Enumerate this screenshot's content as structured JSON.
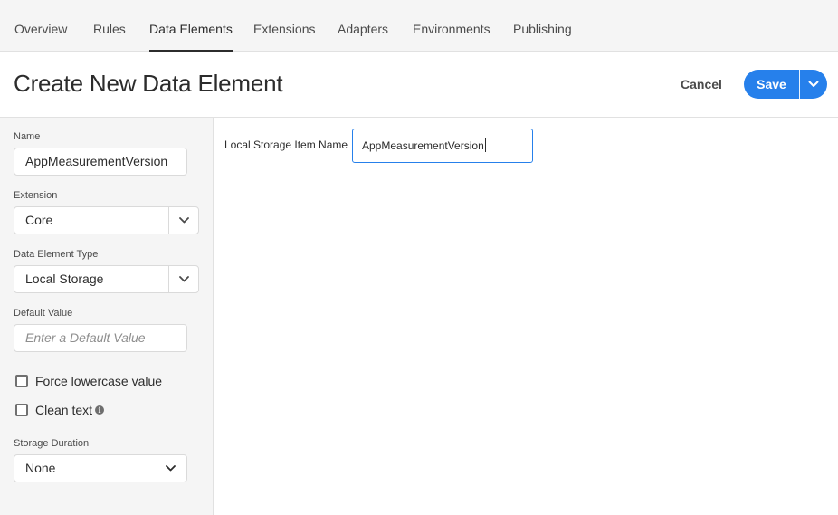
{
  "nav": {
    "tabs": [
      {
        "label": "Overview"
      },
      {
        "label": "Rules"
      },
      {
        "label": "Data Elements"
      },
      {
        "label": "Extensions"
      },
      {
        "label": "Adapters"
      },
      {
        "label": "Environments"
      },
      {
        "label": "Publishing"
      }
    ],
    "active": "Data Elements"
  },
  "header": {
    "title": "Create New Data Element",
    "cancel_label": "Cancel",
    "save_label": "Save"
  },
  "sidebar": {
    "name": {
      "label": "Name",
      "value": "AppMeasurementVersion"
    },
    "extension": {
      "label": "Extension",
      "value": "Core"
    },
    "data_element_type": {
      "label": "Data Element Type",
      "value": "Local Storage"
    },
    "default_value": {
      "label": "Default Value",
      "placeholder": "Enter a Default Value"
    },
    "force_lowercase": {
      "label": "Force lowercase value",
      "checked": false
    },
    "clean_text": {
      "label": "Clean text",
      "checked": false,
      "info_icon": "info-icon"
    },
    "storage_duration": {
      "label": "Storage Duration",
      "value": "None"
    }
  },
  "main": {
    "item_name": {
      "label": "Local Storage Item Name",
      "value": "AppMeasurementVersion"
    }
  },
  "colors": {
    "accent": "#2680eb",
    "panel_bg": "#f5f5f5"
  }
}
